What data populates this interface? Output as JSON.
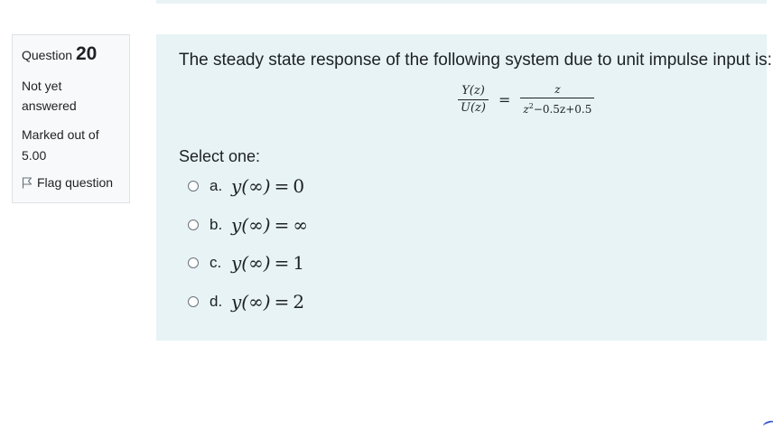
{
  "info": {
    "question_label": "Question",
    "question_number": "20",
    "state_line1": "Not yet",
    "state_line2": "answered",
    "grade_line1": "Marked out of",
    "grade_line2": "5.00",
    "flag_label": "Flag question",
    "flag_icon": "flag-outline-icon"
  },
  "question": {
    "text": "The steady state response of the following system due to unit impulse input is:",
    "formula": {
      "lhs_num": "Y(z)",
      "lhs_den": "U(z)",
      "eq": "=",
      "rhs_num": "z",
      "rhs_den_z": "z",
      "rhs_den_exp": "2",
      "rhs_den_rest": "−0.5z+0.5"
    },
    "prompt": "Select one:",
    "options": [
      {
        "letter": "a.",
        "lhs": "y(∞)",
        "eq": "=",
        "rhs": "0"
      },
      {
        "letter": "b.",
        "lhs": "y(∞)",
        "eq": "=",
        "rhs": "∞"
      },
      {
        "letter": "c.",
        "lhs": "y(∞)",
        "eq": "=",
        "rhs": "1"
      },
      {
        "letter": "d.",
        "lhs": "y(∞)",
        "eq": "=",
        "rhs": "2"
      }
    ]
  },
  "colors": {
    "content_bg": "#e7f3f5",
    "info_bg": "#f8f9fa",
    "text": "#1d2125"
  }
}
